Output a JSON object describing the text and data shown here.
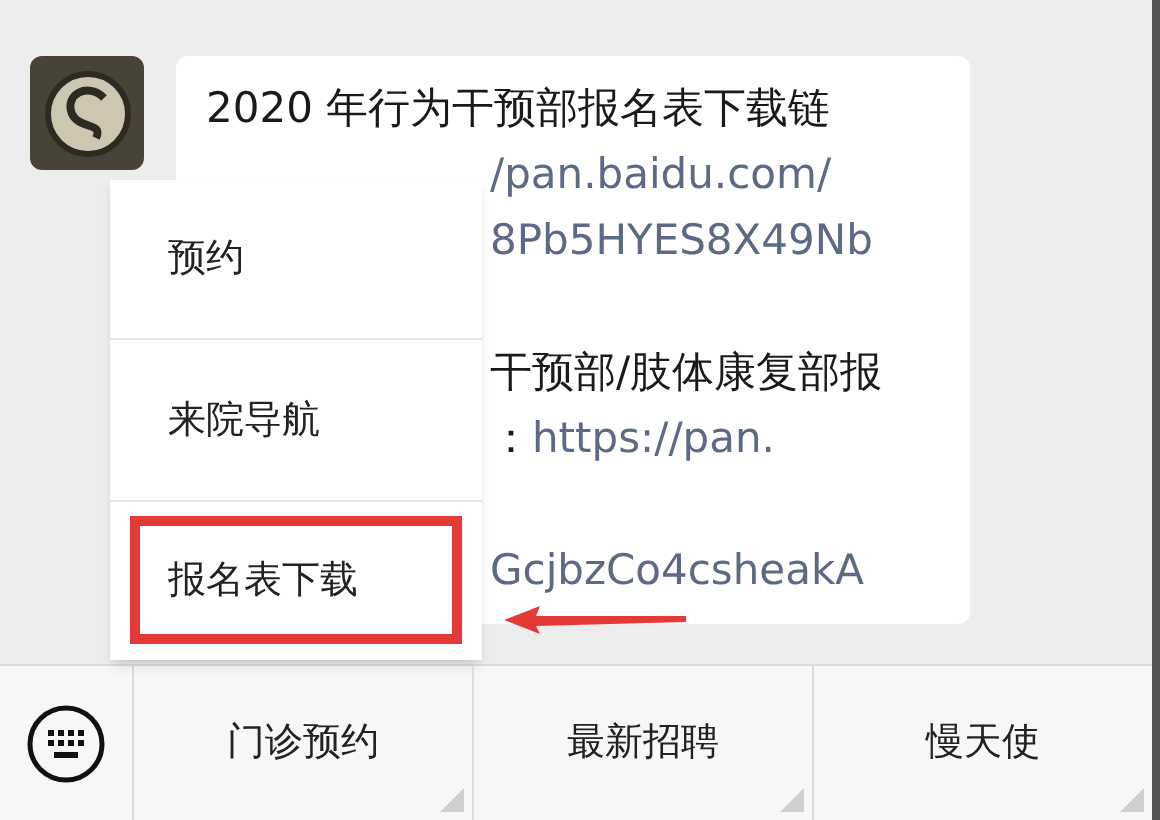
{
  "message": {
    "lines": [
      {
        "kind": "full",
        "parts": [
          {
            "text": "2020 年行为干预部报名表下载链",
            "link": false
          }
        ]
      },
      {
        "kind": "partial",
        "parts": [
          {
            "text": "/pan.baidu.com/",
            "link": true
          }
        ]
      },
      {
        "kind": "partial",
        "parts": [
          {
            "text": "8Pb5HYES8X49Nb",
            "link": true
          }
        ]
      },
      {
        "kind": "blank"
      },
      {
        "kind": "partial",
        "parts": [
          {
            "text": "干预部/肢体康复部报",
            "link": false
          }
        ]
      },
      {
        "kind": "partial",
        "parts": [
          {
            "text": "：",
            "link": false
          },
          {
            "text": "https://pan.",
            "link": true
          }
        ]
      },
      {
        "kind": "blank"
      },
      {
        "kind": "partial",
        "parts": [
          {
            "text": "GcjbzCo4csheakA",
            "link": true
          }
        ]
      }
    ]
  },
  "popup_menu": {
    "items": [
      {
        "label": "预约",
        "highlighted": false
      },
      {
        "label": "来院导航",
        "highlighted": false
      },
      {
        "label": "报名表下载",
        "highlighted": true
      }
    ]
  },
  "bottom_menu": {
    "items": [
      {
        "label": "门诊预约",
        "has_submenu": true
      },
      {
        "label": "最新招聘",
        "has_submenu": true
      },
      {
        "label": "慢天使",
        "has_submenu": true
      }
    ]
  }
}
